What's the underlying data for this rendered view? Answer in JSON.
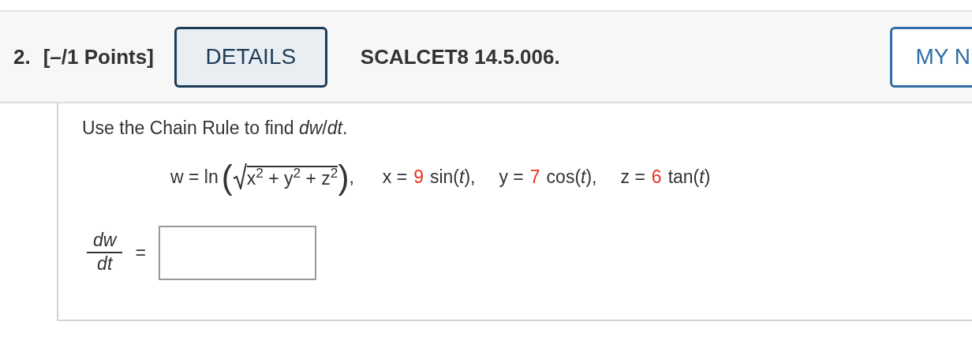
{
  "question": {
    "number": "2.",
    "points": "[–/1 Points]",
    "details_button": "DETAILS",
    "code": "SCALCET8 14.5.006.",
    "my_notes_button": "MY N"
  },
  "prompt": "Use the Chain Rule to find *dw*/*dt*.",
  "function": {
    "lhs": "w = ln",
    "open": "(",
    "radicand": "x$^{2}$ + y$^{2}$ + z$^{2}$",
    "close": ")",
    "separator": ","
  },
  "params": [
    {
      "lhs": "x =",
      "coef": "9",
      "rest": "sin(*t*),"
    },
    {
      "lhs": "y =",
      "coef": "7",
      "rest": "cos(*t*),"
    },
    {
      "lhs": "z =",
      "coef": "6",
      "rest": "tan(*t*)"
    }
  ],
  "answer": {
    "numerator": "dw",
    "denominator": "dt",
    "equals": "="
  }
}
